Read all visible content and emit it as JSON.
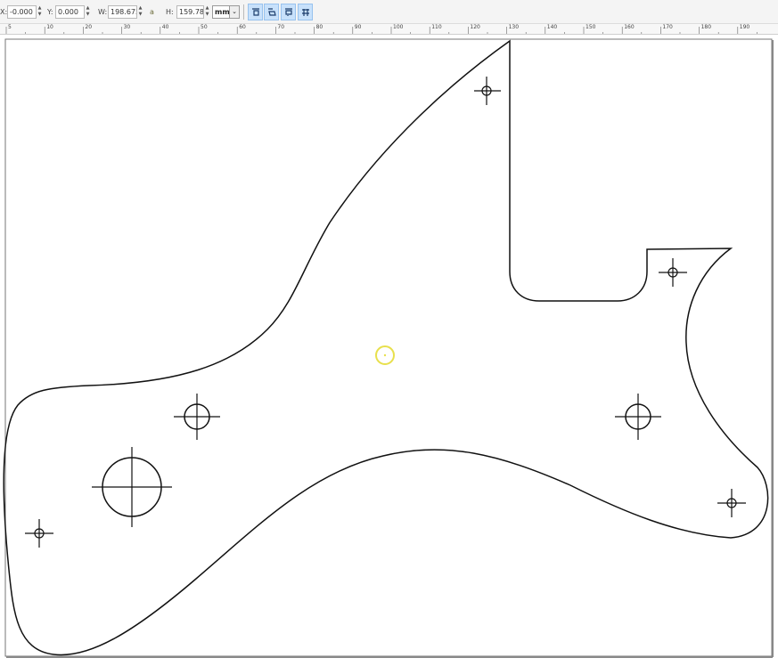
{
  "toolbar": {
    "x_label": "X:",
    "x_value": "-0.000",
    "y_label": "Y:",
    "y_value": "0.000",
    "w_label": "W:",
    "w_value": "198.675",
    "lock_glyph": "a",
    "h_label": "H:",
    "h_value": "159.789",
    "unit": "mm",
    "buttons": [
      "align-top-icon",
      "align-rotate-icon",
      "align-bottom-icon",
      "align-grid-icon"
    ]
  },
  "ruler": {
    "labels": [
      "5",
      "10",
      "20",
      "30",
      "40",
      "50",
      "60",
      "70",
      "80",
      "90",
      "100",
      "110",
      "120",
      "130",
      "140",
      "150",
      "160",
      "170",
      "180",
      "190"
    ]
  },
  "colors": {
    "selection_circle": "#e8e04c",
    "outline": "#111111",
    "button_bg": "#c8e1fb"
  }
}
